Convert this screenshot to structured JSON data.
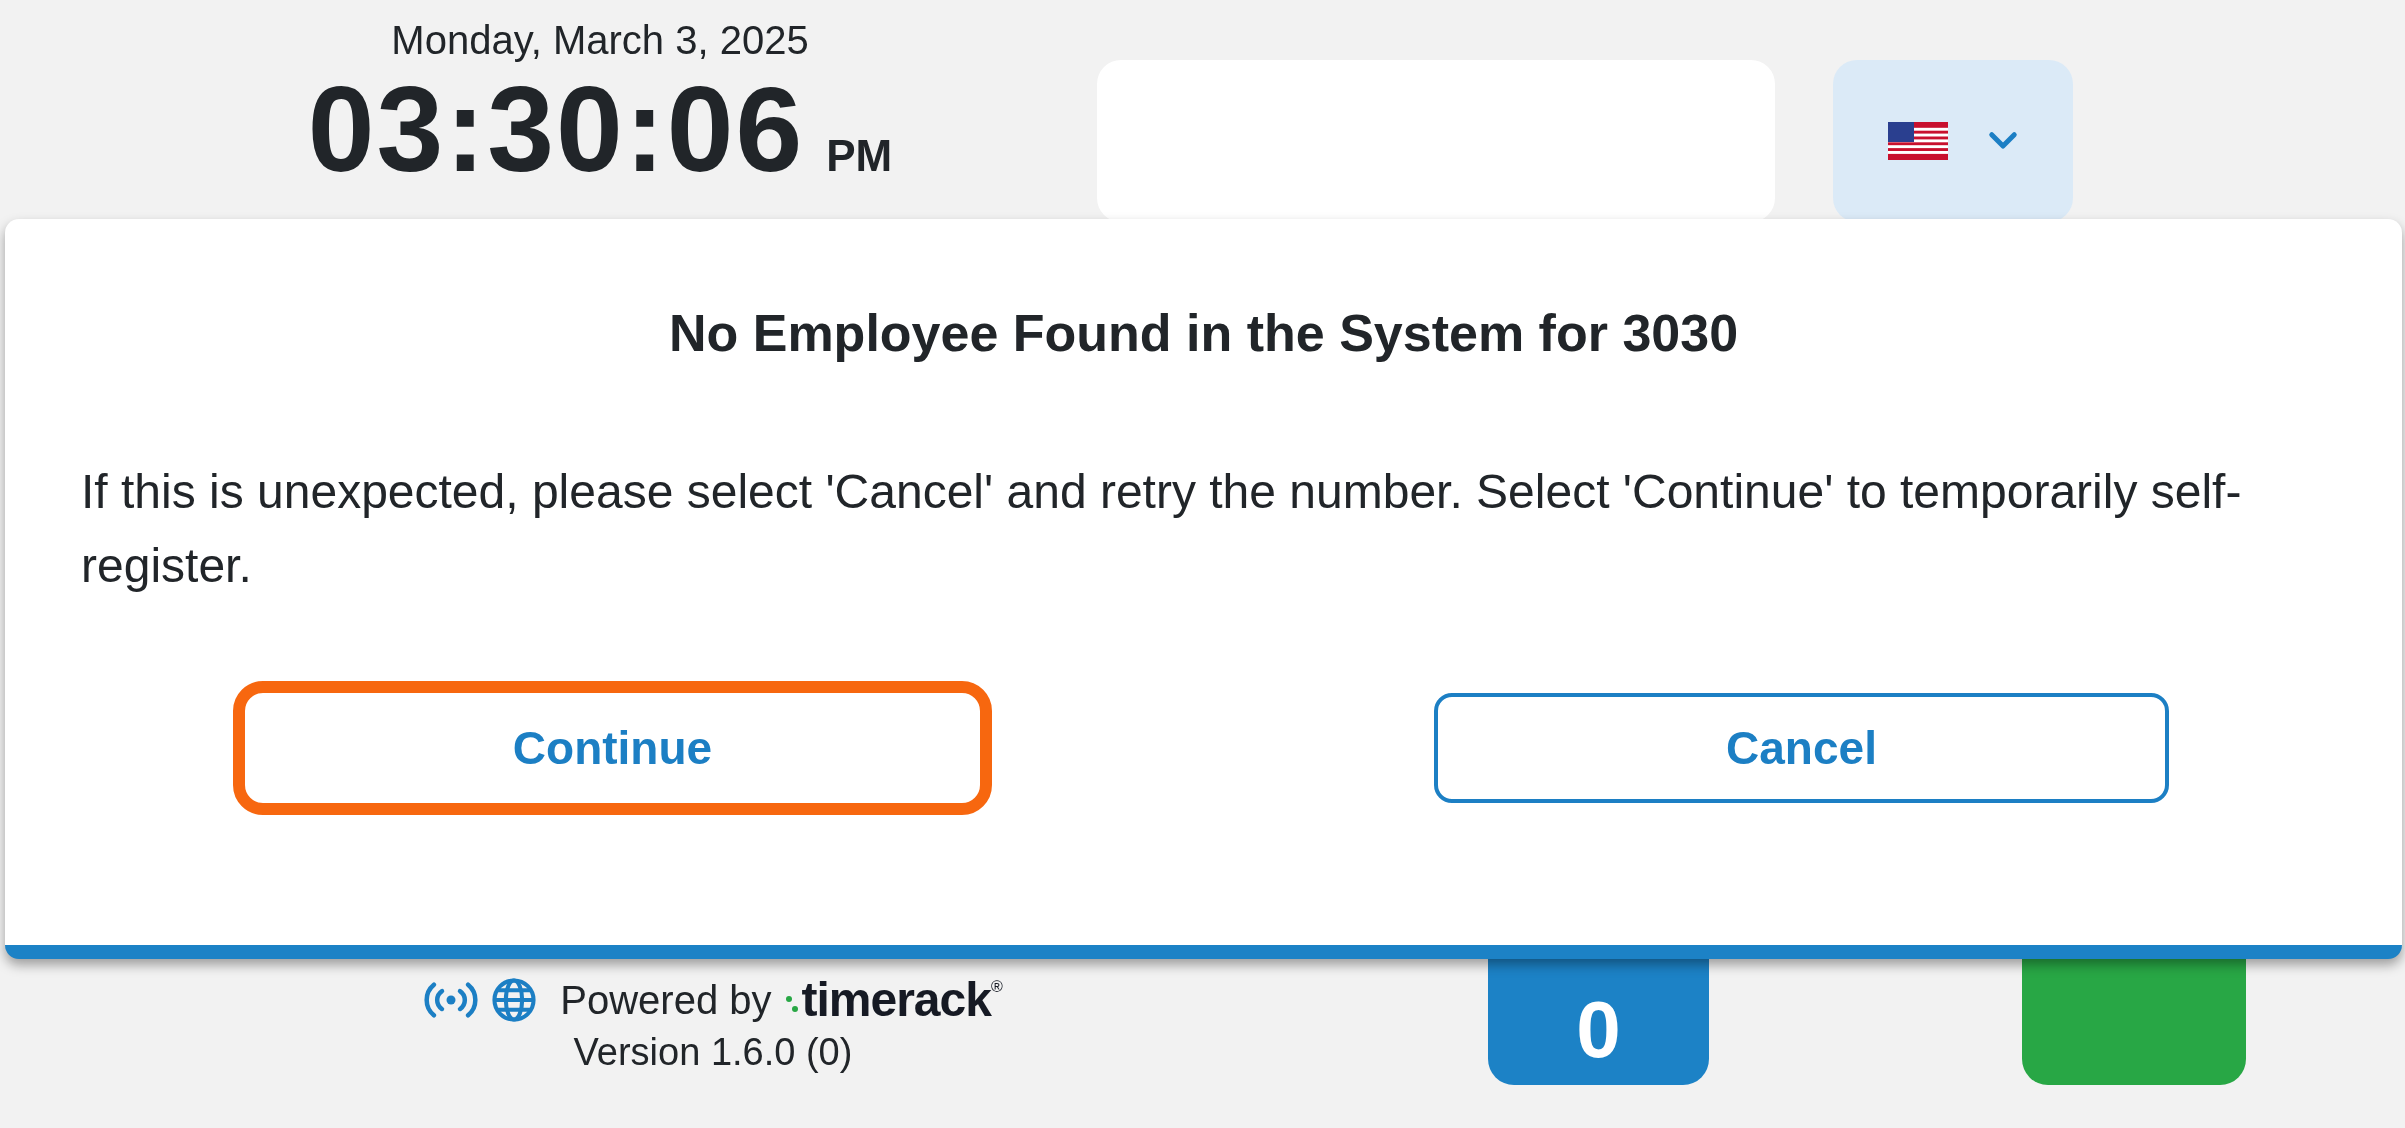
{
  "header": {
    "date": "Monday, March 3, 2025",
    "time": "03:30:06",
    "meridiem": "PM"
  },
  "dialog": {
    "title": "No Employee Found in the System for 3030",
    "message": "If this is unexpected, please select 'Cancel' and retry the number. Select 'Continue' to temporarily self-register.",
    "buttons": [
      {
        "label": "Continue",
        "focused": true
      },
      {
        "label": "Cancel",
        "focused": false
      }
    ]
  },
  "footer": {
    "powered_by": "Powered by",
    "logo": "timerack",
    "logo_mark": "®",
    "version": "Version 1.6.0 (0)"
  },
  "tiles": [
    {
      "color": "#1c82c6",
      "label": "0"
    },
    {
      "color": "#28a745"
    }
  ]
}
